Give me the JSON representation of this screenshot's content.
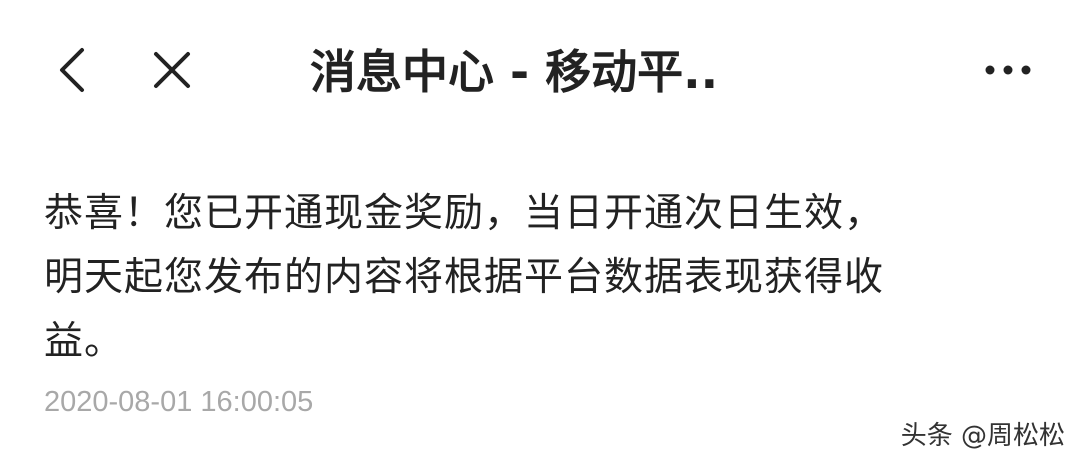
{
  "nav": {
    "back_icon": "chevron-left-icon",
    "close_icon": "close-icon",
    "more_icon": "more-horizontal-icon",
    "title": "消息中心 - 移动平.."
  },
  "message": {
    "lines": [
      "恭喜！您已开通现金奖励，当日开通次日生效，",
      "明天起您发布的内容将根据平台数据表现获得收",
      "益。"
    ],
    "timestamp": "2020-08-01 16:00:05"
  },
  "watermark": {
    "text": "头条 @周松松"
  },
  "colors": {
    "text": "#222222",
    "timestamp": "#a8a8a8",
    "background": "#ffffff"
  }
}
